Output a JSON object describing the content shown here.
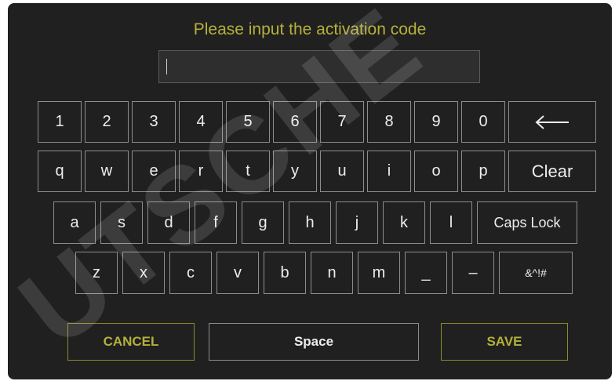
{
  "dialog": {
    "title": "Please input the activation code",
    "input_value": ""
  },
  "keyboard": {
    "row1": [
      "1",
      "2",
      "3",
      "4",
      "5",
      "6",
      "7",
      "8",
      "9",
      "0"
    ],
    "backspace_icon": "arrow-left-icon",
    "row2": [
      "q",
      "w",
      "e",
      "r",
      "t",
      "y",
      "u",
      "i",
      "o",
      "p"
    ],
    "clear_label": "Clear",
    "row3": [
      "a",
      "s",
      "d",
      "f",
      "g",
      "h",
      "j",
      "k",
      "l"
    ],
    "caps_label": "Caps Lock",
    "row4": [
      "z",
      "x",
      "c",
      "v",
      "b",
      "n",
      "m",
      "_",
      "–"
    ],
    "symbols_label": "&^!#"
  },
  "actions": {
    "cancel_label": "CANCEL",
    "space_label": "Space",
    "save_label": "SAVE"
  },
  "watermark": "UTSCHE",
  "colors": {
    "background": "#202020",
    "accent": "#b5b03a",
    "key_border": "#8d8d8d"
  }
}
